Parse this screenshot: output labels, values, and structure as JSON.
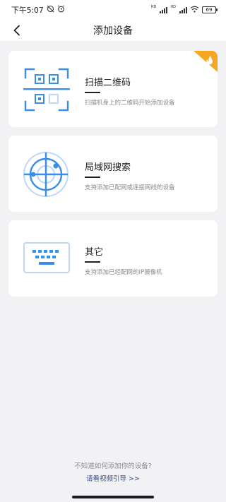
{
  "status_bar": {
    "time": "下午5:07",
    "hd1": "HD",
    "hd2": "HD",
    "battery": "69"
  },
  "header": {
    "title": "添加设备",
    "back_icon": "chevron-left-icon"
  },
  "cards": [
    {
      "title": "扫描二维码",
      "desc": "扫描机身上的二维码开始添加设备",
      "icon": "qr-scan-icon",
      "badge": "hot-flame-icon"
    },
    {
      "title": "局域网搜索",
      "desc": "支持添加已配网或连接网线的设备",
      "icon": "lan-radar-icon"
    },
    {
      "title": "其它",
      "desc": "支持添加已经配网的IP摄像机",
      "icon": "keyboard-icon"
    }
  ],
  "footer": {
    "question": "不知道如何添加你的设备?",
    "guide_link": "请看视频引导 >>"
  },
  "colors": {
    "accent_blue": "#3a8ee6",
    "light_blue": "#bcd8f5",
    "badge_orange": "#f5a623",
    "background": "#f2f2f5"
  }
}
